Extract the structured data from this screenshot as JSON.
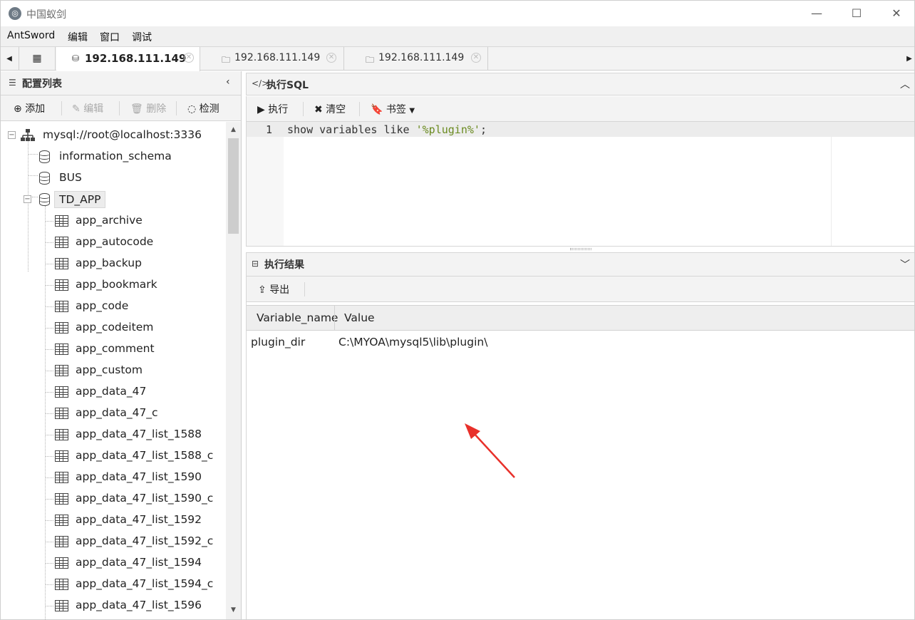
{
  "window": {
    "title": "中国蚁剑",
    "minimize": "—",
    "maximize": "☐",
    "close": "✕"
  },
  "menu": [
    "AntSword",
    "编辑",
    "窗口",
    "调试"
  ],
  "tabs": {
    "home_icon": "grid-icon",
    "items": [
      {
        "label": "192.168.111.149",
        "icon": "database-icon",
        "active": true
      },
      {
        "label": "192.168.111.149",
        "icon": "folder-icon",
        "active": false
      },
      {
        "label": "192.168.111.149",
        "icon": "folder-icon",
        "active": false
      }
    ]
  },
  "left_panel": {
    "title": "配置列表",
    "toolbar": {
      "add": "添加",
      "edit": "编辑",
      "delete": "删除",
      "test": "检测"
    },
    "connection": "mysql://root@localhost:3336",
    "databases": [
      "information_schema",
      "BUS",
      "TD_APP"
    ],
    "selected_database": "TD_APP",
    "tables": [
      "app_archive",
      "app_autocode",
      "app_backup",
      "app_bookmark",
      "app_code",
      "app_codeitem",
      "app_comment",
      "app_custom",
      "app_data_47",
      "app_data_47_c",
      "app_data_47_list_1588",
      "app_data_47_list_1588_c",
      "app_data_47_list_1590",
      "app_data_47_list_1590_c",
      "app_data_47_list_1592",
      "app_data_47_list_1592_c",
      "app_data_47_list_1594",
      "app_data_47_list_1594_c",
      "app_data_47_list_1596"
    ]
  },
  "sql_panel": {
    "title": "执行SQL",
    "toolbar": {
      "execute": "执行",
      "clear": "清空",
      "bookmark": "书签"
    },
    "line_number": "1",
    "code_prefix": "show variables like ",
    "code_string": "'%plugin%'",
    "code_suffix": ";"
  },
  "result_panel": {
    "title": "执行结果",
    "export": "导出",
    "columns": [
      "Variable_name",
      "Value"
    ],
    "rows": [
      [
        "plugin_dir",
        "C:\\MYOA\\mysql5\\lib\\plugin\\"
      ]
    ],
    "annotation_color": "#e8302a"
  }
}
